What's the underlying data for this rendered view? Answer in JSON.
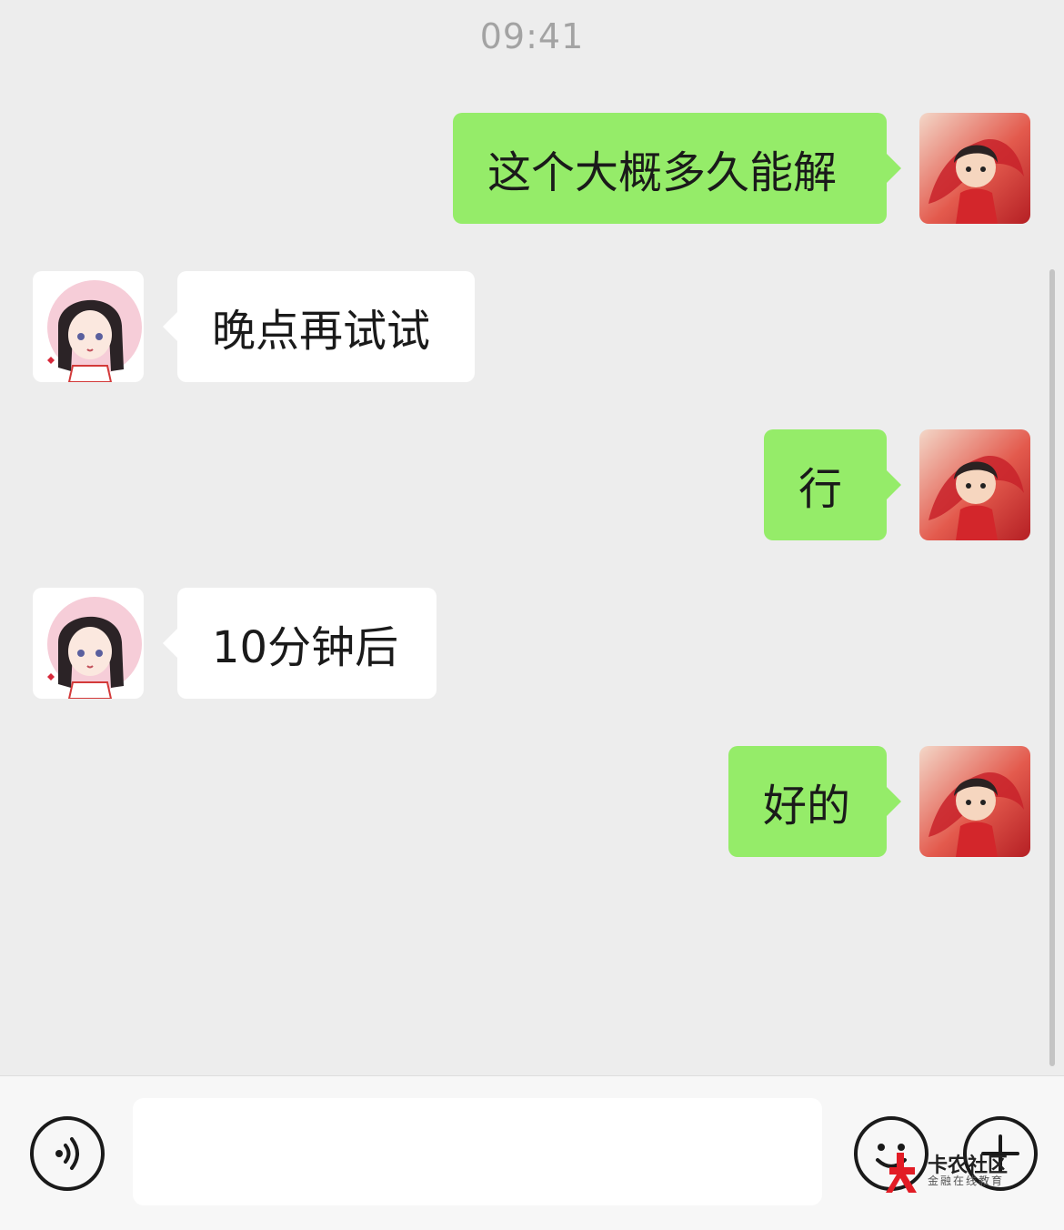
{
  "status": {
    "time": "09:41"
  },
  "colors": {
    "background": "#ededed",
    "my_bubble": "#95ec69",
    "their_bubble": "#ffffff"
  },
  "messages": [
    {
      "sender": "me",
      "text": "这个大概多久能解"
    },
    {
      "sender": "them",
      "text": "晚点再试试"
    },
    {
      "sender": "me",
      "text": "行"
    },
    {
      "sender": "them",
      "text": "10分钟后"
    },
    {
      "sender": "me",
      "text": "好的"
    }
  ],
  "input_bar": {
    "voice_icon": "voice-icon",
    "message_value": "",
    "emoji_icon": "emoji-icon",
    "plus_icon": "plus-icon"
  },
  "watermark": {
    "main": "卡农社区",
    "sub": "金融在线教育"
  }
}
